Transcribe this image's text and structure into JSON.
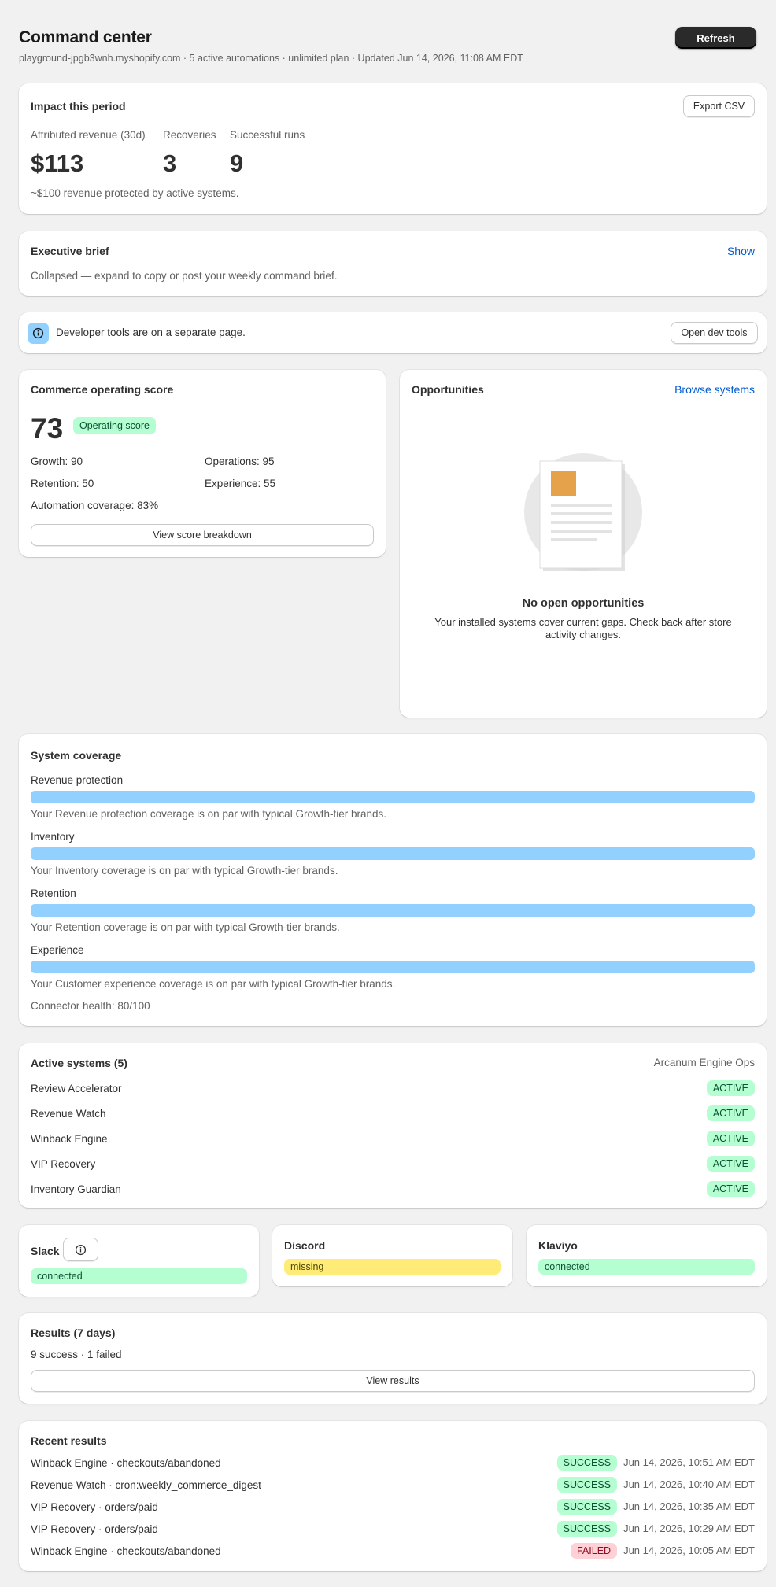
{
  "header": {
    "title": "Command center",
    "subtitle": "playground-jpgb3wnh.myshopify.com · 5 active automations · unlimited plan · Updated Jun 14, 2026, 11:08 AM EDT",
    "refresh_label": "Refresh"
  },
  "impact": {
    "title": "Impact this period",
    "export_label": "Export CSV",
    "metrics": [
      {
        "label": "Attributed revenue (30d)",
        "value": "$113"
      },
      {
        "label": "Recoveries",
        "value": "3"
      },
      {
        "label": "Successful runs",
        "value": "9"
      }
    ],
    "note": "~$100 revenue protected by active systems."
  },
  "brief": {
    "title": "Executive brief",
    "toggle_label": "Show",
    "text": "Collapsed — expand to copy or post your weekly command brief."
  },
  "devtools": {
    "text": "Developer tools are on a separate page.",
    "button_label": "Open dev tools",
    "icon": "info-icon"
  },
  "score": {
    "title": "Commerce operating score",
    "value": "73",
    "badge": "Operating score",
    "items": [
      "Growth: 90",
      "Operations: 95",
      "Retention: 50",
      "Experience: 55"
    ],
    "coverage": "Automation coverage: 83%",
    "button_label": "View score breakdown"
  },
  "opportunities": {
    "title": "Opportunities",
    "link_label": "Browse systems",
    "empty_title": "No open opportunities",
    "empty_text": "Your installed systems cover current gaps. Check back after store activity changes."
  },
  "coverage": {
    "title": "System coverage",
    "rows": [
      {
        "label": "Revenue protection",
        "fill": 1.0,
        "note": "Your Revenue protection coverage is on par with typical Growth-tier brands."
      },
      {
        "label": "Inventory",
        "fill": 1.0,
        "note": "Your Inventory coverage is on par with typical Growth-tier brands."
      },
      {
        "label": "Retention",
        "fill": 1.0,
        "note": "Your Retention coverage is on par with typical Growth-tier brands."
      },
      {
        "label": "Experience",
        "fill": 1.0,
        "note": "Your Customer experience coverage is on par with typical Growth-tier brands."
      }
    ],
    "health": "Connector health: 80/100",
    "fill_color": "#91d0ff"
  },
  "active": {
    "title": "Active systems (5)",
    "owner": "Arcanum Engine Ops",
    "systems": [
      {
        "name": "Review Accelerator",
        "status": "ACTIVE"
      },
      {
        "name": "Revenue Watch",
        "status": "ACTIVE"
      },
      {
        "name": "Winback Engine",
        "status": "ACTIVE"
      },
      {
        "name": "VIP Recovery",
        "status": "ACTIVE"
      },
      {
        "name": "Inventory Guardian",
        "status": "ACTIVE"
      }
    ]
  },
  "connectors": [
    {
      "name": "Slack",
      "status": "connected",
      "icon": "info-icon"
    },
    {
      "name": "Discord",
      "status": "missing"
    },
    {
      "name": "Klaviyo",
      "status": "connected"
    }
  ],
  "results": {
    "title": "Results (7 days)",
    "summary": "9 success · 1 failed",
    "button_label": "View results"
  },
  "recent": {
    "title": "Recent results",
    "rows": [
      {
        "name": "Winback Engine · checkouts/abandoned",
        "status": "SUCCESS",
        "time": "Jun 14, 2026, 10:51 AM EDT"
      },
      {
        "name": "Revenue Watch · cron:weekly_commerce_digest",
        "status": "SUCCESS",
        "time": "Jun 14, 2026, 10:40 AM EDT"
      },
      {
        "name": "VIP Recovery · orders/paid",
        "status": "SUCCESS",
        "time": "Jun 14, 2026, 10:35 AM EDT"
      },
      {
        "name": "VIP Recovery · orders/paid",
        "status": "SUCCESS",
        "time": "Jun 14, 2026, 10:29 AM EDT"
      },
      {
        "name": "Winback Engine · checkouts/abandoned",
        "status": "FAILED",
        "time": "Jun 14, 2026, 10:05 AM EDT"
      }
    ]
  },
  "colors": {
    "success_bg": "#b4fed2",
    "fail_bg": "#fed1d7",
    "warn_bg": "#ffeb78",
    "link": "#005bd3"
  }
}
